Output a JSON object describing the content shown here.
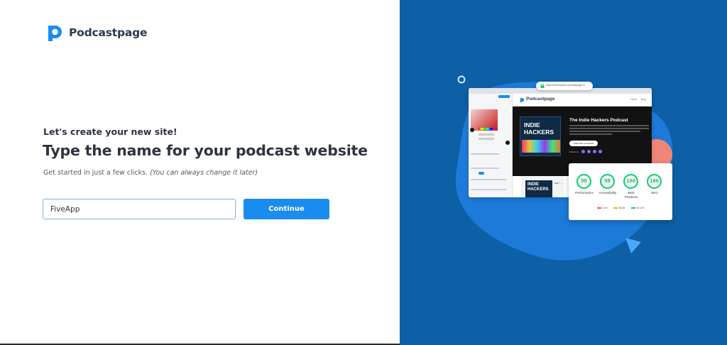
{
  "brand": {
    "name": "Podcastpage",
    "accent": "#1a8cf0",
    "panel_bg": "#0d5fa6"
  },
  "kicker": "Let's create your new site!",
  "headline": "Type the name for your podcast website",
  "subtitle": {
    "text": "Get started in just a few clicks.",
    "note": "(You can always change it later)"
  },
  "site_name_input": {
    "value": "FiveApp"
  },
  "continue_button": {
    "label": "Continue"
  },
  "illustration": {
    "url_bar": "https://indiehackers.podcastpage.io",
    "mock_logo": "Podcastpage",
    "nav": [
      "Home",
      "Blog"
    ],
    "podcast_title": "The Indie Hackers Podcast",
    "cover_line1": "INDIE",
    "cover_line2": "HACKERS",
    "subscribe_label": "Subscribe to Podcast",
    "follow_label": "Follow Us",
    "episode_code": "#167 - ...",
    "lighthouse": {
      "scores": [
        {
          "value": "98",
          "label": "Performance"
        },
        {
          "value": "98",
          "label": "Accessibility"
        },
        {
          "value": "100",
          "label": "Best Practices"
        },
        {
          "value": "100",
          "label": "SEO"
        }
      ],
      "legend": [
        {
          "range": "0-49",
          "color": "#ff4e42"
        },
        {
          "range": "50-89",
          "color": "#ffa400"
        },
        {
          "range": "90-100",
          "color": "#0cce6b"
        }
      ]
    }
  }
}
